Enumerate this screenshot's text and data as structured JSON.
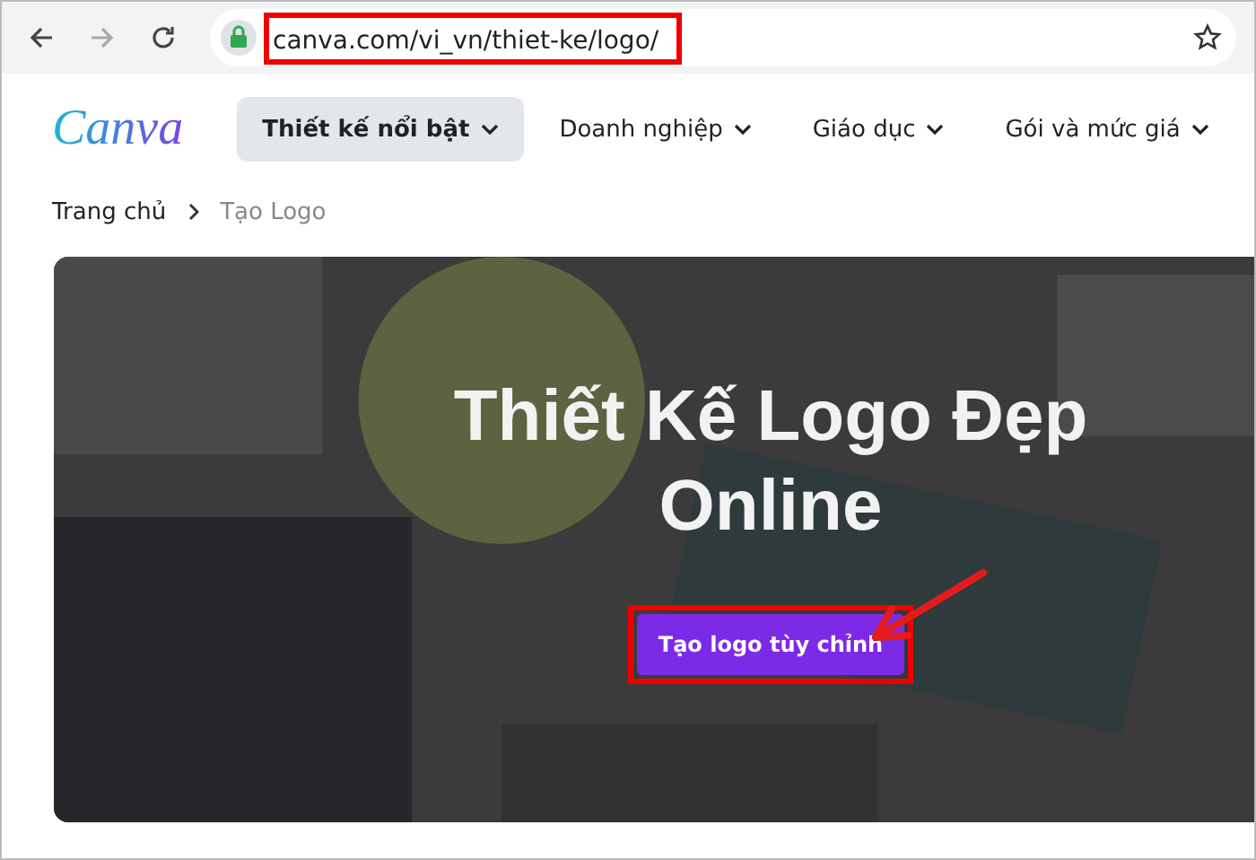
{
  "browser": {
    "nav_buttons": [
      {
        "kind": "back",
        "disabled": false
      },
      {
        "kind": "forward",
        "disabled": true
      },
      {
        "kind": "reload",
        "disabled": false
      }
    ],
    "url": "canva.com/vi_vn/thiet-ke/logo/"
  },
  "header": {
    "logo": "Canva",
    "menu": [
      {
        "label": "Thiết kế nổi bật",
        "selected": true
      },
      {
        "label": "Doanh nghiệp",
        "selected": false
      },
      {
        "label": "Giáo dục",
        "selected": false
      },
      {
        "label": "Gói và mức giá",
        "selected": false
      }
    ]
  },
  "breadcrumb": [
    {
      "label": "Trang chủ",
      "current": false
    },
    {
      "label": "Tạo Logo",
      "current": true
    }
  ],
  "hero": {
    "title_lines": [
      "Thiết Kế Logo Đẹp",
      "Online"
    ],
    "button": "Tạo logo tùy chỉnh"
  }
}
